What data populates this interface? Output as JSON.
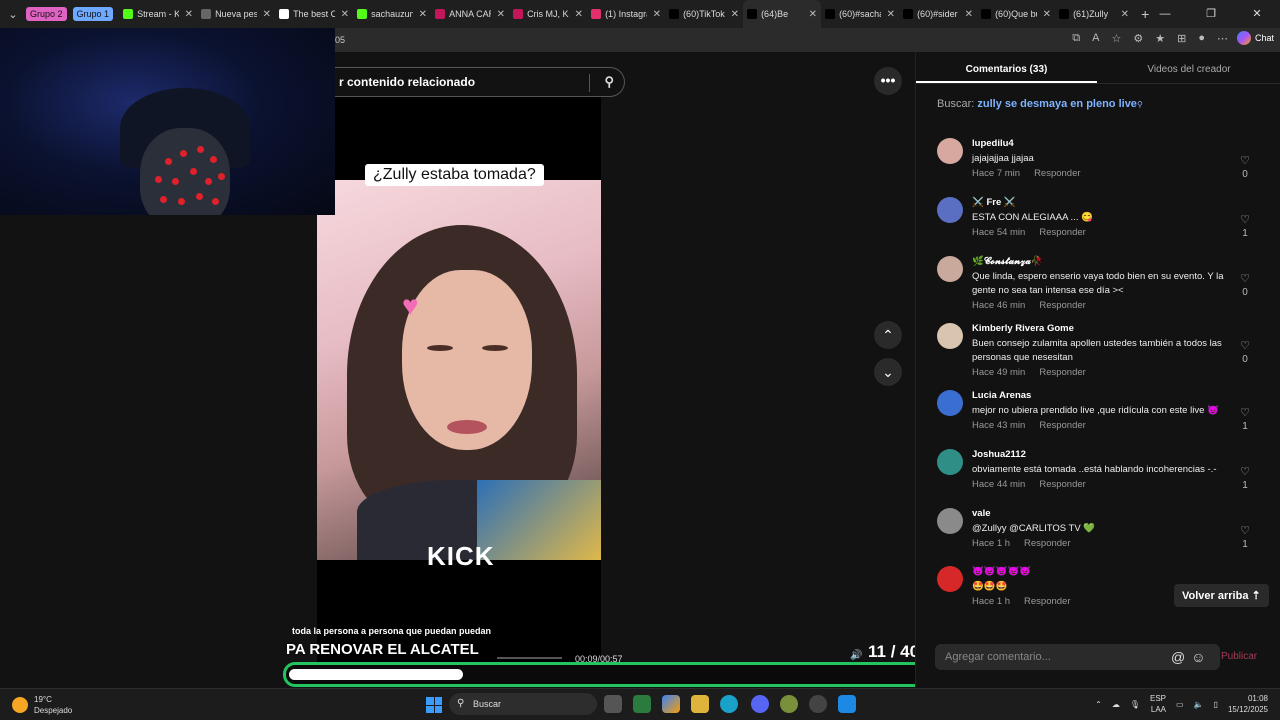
{
  "browser": {
    "groups": [
      {
        "label": "Grupo 2",
        "color": "#e063c3"
      },
      {
        "label": "Grupo 1",
        "color": "#6fa8ff"
      }
    ],
    "tabs": [
      {
        "label": "Stream - Ki",
        "icon": "kick-icon",
        "color": "#53fc18"
      },
      {
        "label": "Nueva pest",
        "icon": "page-icon",
        "color": "#666666"
      },
      {
        "label": "The best C",
        "icon": "diamond-icon",
        "color": "#ffffff"
      },
      {
        "label": "sachauzum",
        "icon": "kick-icon",
        "color": "#53fc18"
      },
      {
        "label": "ANNA CAR",
        "icon": "dot-icon",
        "color": "#c2185b"
      },
      {
        "label": "Cris MJ, Ka",
        "icon": "dot-icon",
        "color": "#c2185b"
      },
      {
        "label": "(1) Instagra",
        "icon": "instagram-icon",
        "color": "#e1306c"
      },
      {
        "label": "(60)TikTok",
        "icon": "tiktok-icon",
        "color": "#000000"
      },
      {
        "label": "(64)Be",
        "icon": "tiktok-icon",
        "color": "#000000"
      },
      {
        "label": "(60)#sacha",
        "icon": "tiktok-icon",
        "color": "#000000"
      },
      {
        "label": "(60)#sider",
        "icon": "tiktok-icon",
        "color": "#000000"
      },
      {
        "label": "(60)Que bu",
        "icon": "tiktok-icon",
        "color": "#000000"
      },
      {
        "label": "(61)Zully",
        "icon": "tiktok-icon",
        "color": "#000000"
      }
    ],
    "url_fragment": "05",
    "chat_label": "Chat"
  },
  "video": {
    "search_placeholder": "r contenido relacionado",
    "caption_top": "¿Zully estaba tomada?",
    "watermark": "KICK",
    "subtitle_small": "toda la persona a persona que puedan puedan",
    "subtitle_big": "PA RENOVAR EL ALCATEL",
    "time": "00:09/00:57",
    "counter": "11 / 40",
    "progress_fraction": 0.27
  },
  "panel": {
    "tab_comments": "Comentarios (33)",
    "tab_creator": "Videos del creador",
    "search_prefix": "Buscar:",
    "search_query": "zully se desmaya en pleno live",
    "reply_label": "Responder",
    "comments": [
      {
        "user": "lupedilu4",
        "text": "jajajajjaa jjajaa",
        "time": "Hace 7 min",
        "likes": "0",
        "avatar": "#d7a8a0"
      },
      {
        "user": "⚔️ Fre ⚔️",
        "text": "ESTA CON ALEGIAAA ... 😋",
        "time": "Hace 54 min",
        "likes": "1",
        "avatar": "#5b6fc2"
      },
      {
        "user": "🌿𝓒𝓸𝓷𝓼𝓽𝓪𝓷𝔃𝓪🥀",
        "text": "Que linda, espero enserio vaya todo bien en su evento. Y la gente no sea tan intensa ese día ><",
        "time": "Hace 46 min",
        "likes": "0",
        "avatar": "#c9a99b"
      },
      {
        "user": "Kimberly Rivera Gome",
        "text": "Buen consejo zulamita apollen ustedes también a todos las personas que nesesitan",
        "time": "Hace 49 min",
        "likes": "0",
        "avatar": "#d8c4b0"
      },
      {
        "user": "Lucia Arenas",
        "text": "mejor no ubiera prendido live ,que ridícula con este live 👿",
        "time": "Hace 43 min",
        "likes": "1",
        "avatar": "#3a6fd1"
      },
      {
        "user": "Joshua2112",
        "text": "obviamente está tomada ..está hablando incoherencias -.-",
        "time": "Hace 44 min",
        "likes": "1",
        "avatar": "#2f8f86"
      },
      {
        "user": "vale",
        "text": "@Zullyy @CARLITOS TV 💚",
        "time": "Hace 1 h",
        "likes": "1",
        "avatar": "#8a8a8a"
      },
      {
        "user": "👿👿👿👿👿",
        "text": "🤩🤩🤩",
        "time": "Hace 1 h",
        "likes": "",
        "avatar": "#d62828"
      }
    ],
    "back_to_top": "Volver arriba",
    "add_comment_placeholder": "Agregar comentario...",
    "publish": "Publicar"
  },
  "taskbar": {
    "temperature": "19°C",
    "weather": "Despejado",
    "search": "Buscar",
    "lang_top": "ESP",
    "lang_bottom": "LAA",
    "time": "01:08",
    "date": "15/12/2025"
  }
}
